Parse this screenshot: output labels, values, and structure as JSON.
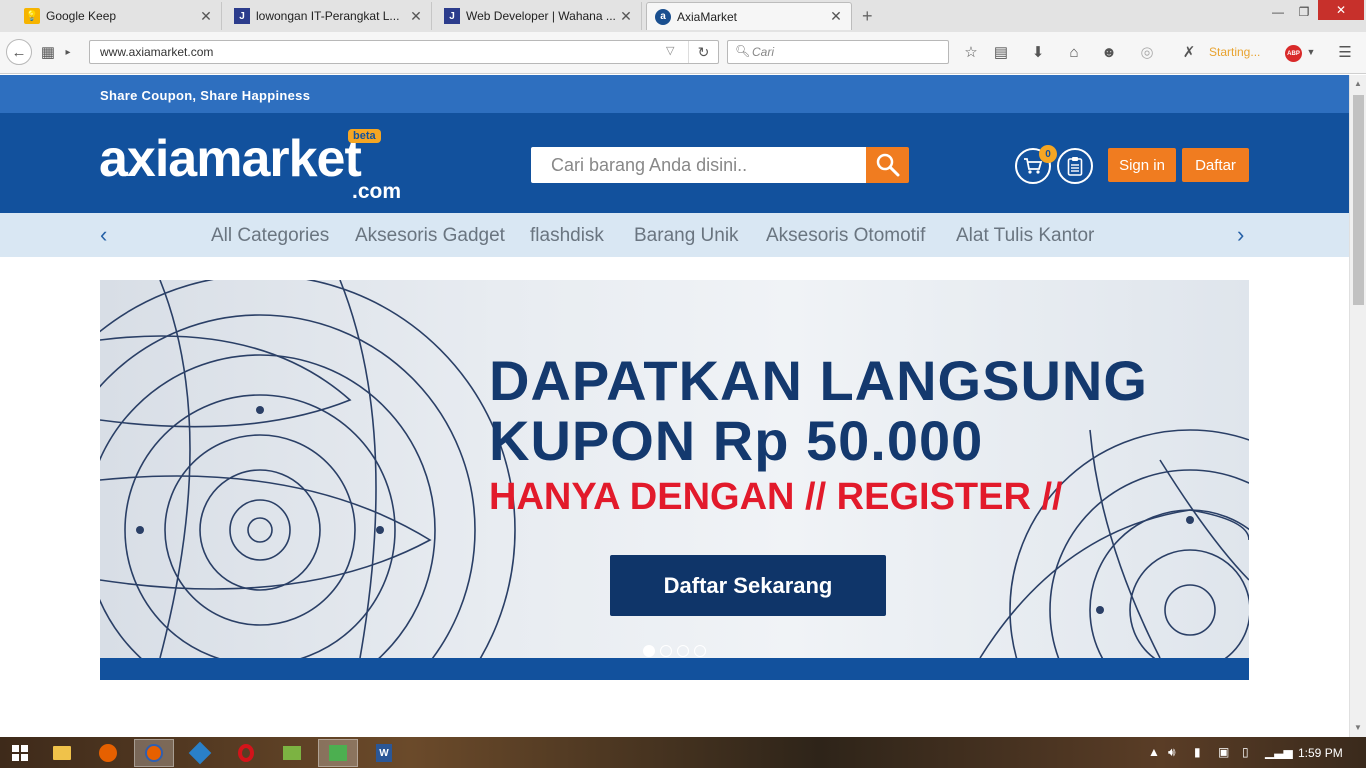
{
  "browser": {
    "tabs": [
      {
        "title": "Google Keep",
        "icon": "google-keep-icon",
        "active": false
      },
      {
        "title": "lowongan IT-Perangkat L...",
        "icon": "j-site-icon",
        "active": false
      },
      {
        "title": "Web Developer | Wahana ...",
        "icon": "j-site-icon",
        "active": false
      },
      {
        "title": "AxiaMarket",
        "icon": "axiamarket-icon",
        "active": true
      }
    ],
    "url": "www.axiamarket.com",
    "search_placeholder": "Cari",
    "status_text": "Starting...",
    "adblock_label": "ABP"
  },
  "site": {
    "tagline": "Share Coupon, Share Happiness",
    "logo": {
      "name": "axiamarket",
      "suffix": ".com",
      "badge": "beta"
    },
    "search_placeholder": "Cari barang Anda disini..",
    "cart_count": "0",
    "signin_label": "Sign in",
    "register_label": "Daftar",
    "categories": [
      "All Categories",
      "Aksesoris Gadget",
      "flashdisk",
      "Barang Unik",
      "Aksesoris Otomotif",
      "Alat Tulis Kantor"
    ],
    "banner": {
      "line1": "DAPATKAN LANGSUNG",
      "line2": "KUPON Rp 50.000",
      "line3": "HANYA DENGAN // REGISTER //",
      "cta": "Daftar Sekarang",
      "slides": 4,
      "active_slide": 1
    },
    "colors": {
      "brand_blue": "#12519d",
      "accent_orange": "#f07c20",
      "headline_red": "#e21a2b"
    }
  },
  "taskbar": {
    "clock": "1:59 PM"
  }
}
